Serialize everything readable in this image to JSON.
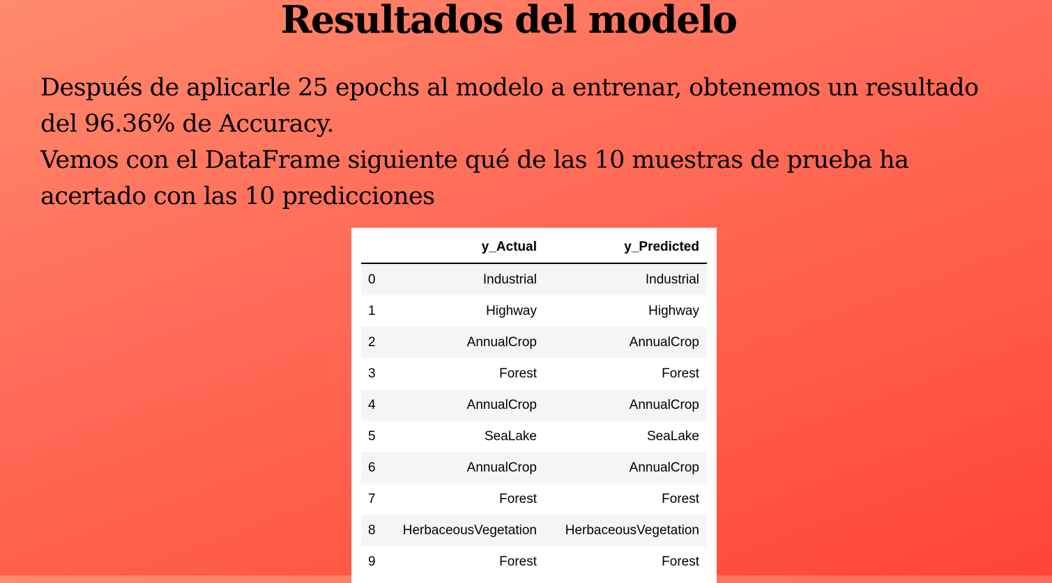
{
  "slide": {
    "title": "Resultados del modelo",
    "paragraphs": [
      "Después de aplicarle 25 epochs al modelo a entrenar, obtenemos un resultado del 96.36% de Accuracy.",
      "Vemos con el DataFrame siguiente qué de las 10 muestras de prueba ha acertado con las 10 predicciones"
    ]
  },
  "dataframe": {
    "columns": [
      "",
      "y_Actual",
      "y_Predicted"
    ],
    "rows": [
      {
        "index": "0",
        "y_actual": "Industrial",
        "y_predicted": "Industrial"
      },
      {
        "index": "1",
        "y_actual": "Highway",
        "y_predicted": "Highway"
      },
      {
        "index": "2",
        "y_actual": "AnnualCrop",
        "y_predicted": "AnnualCrop"
      },
      {
        "index": "3",
        "y_actual": "Forest",
        "y_predicted": "Forest"
      },
      {
        "index": "4",
        "y_actual": "AnnualCrop",
        "y_predicted": "AnnualCrop"
      },
      {
        "index": "5",
        "y_actual": "SeaLake",
        "y_predicted": "SeaLake"
      },
      {
        "index": "6",
        "y_actual": "AnnualCrop",
        "y_predicted": "AnnualCrop"
      },
      {
        "index": "7",
        "y_actual": "Forest",
        "y_predicted": "Forest"
      },
      {
        "index": "8",
        "y_actual": "HerbaceousVegetation",
        "y_predicted": "HerbaceousVegetation"
      },
      {
        "index": "9",
        "y_actual": "Forest",
        "y_predicted": "Forest"
      }
    ]
  },
  "colors": {
    "background_start": "#ff8a6c",
    "background_end": "#ff4438",
    "table_stripe": "#f5f5f5"
  }
}
